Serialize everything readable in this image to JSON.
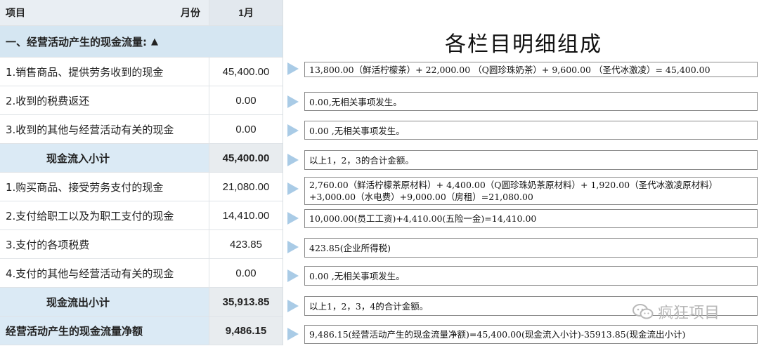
{
  "table": {
    "header": {
      "item": "项目",
      "month": "月份",
      "col": "1月"
    },
    "section": "一、经营活动产生的现金流量:",
    "rows": [
      {
        "label": "1.销售商品、提供劳务收到的现金",
        "value": "45,400.00"
      },
      {
        "label": "2.收到的税费返还",
        "value": "0.00"
      },
      {
        "label": "3.收到的其他与经营活动有关的现金",
        "value": "0.00"
      },
      {
        "label": "现金流入小计",
        "value": "45,400.00"
      },
      {
        "label": "1.购买商品、接受劳务支付的现金",
        "value": "21,080.00"
      },
      {
        "label": "2.支付给职工以及为职工支付的现金",
        "value": "14,410.00"
      },
      {
        "label": "3.支付的各项税费",
        "value": "423.85"
      },
      {
        "label": "4.支付的其他与经营活动有关的现金",
        "value": "0.00"
      },
      {
        "label": "现金流出小计",
        "value": "35,913.85"
      },
      {
        "label": "经营活动产生的现金流量净额",
        "value": "9,486.15"
      }
    ]
  },
  "panel": {
    "title": "各栏目明细组成",
    "notes": [
      "13,800.00（鲜活柠檬茶）+ 22,000.00 （Q圆珍珠奶茶）+ 9,600.00 （圣代冰激凌）= 45,400.00",
      "0.00,无相关事项发生。",
      "0.00 ,无相关事项发生。",
      "以上1，2，3的合计金额。",
      "2,760.00（鲜活柠檬茶原材料）+ 4,400.00（Q圆珍珠奶茶原材料）+ 1,920.00（圣代冰激凌原材料）+3,000.00（水电费）+9,000.00（房租）=21,080.00",
      "10,000.00(员工工资)+4,410.00(五险一金)=14,410.00",
      "423.85(企业所得税)",
      "0.00 ,无相关事项发生。",
      "以上1，2，3，4的合计金额。",
      "9,486.15(经营活动产生的现金流量净额)=45,400.00(现金流入小计)-35913.85(现金流出小计)"
    ]
  },
  "watermark": {
    "text": "疯狂项目",
    "icon": "wechat-icon"
  },
  "colors": {
    "section_bg": "#d5e6f2",
    "arrow": "#a9cbe6",
    "header_bg": "#e9eef3"
  }
}
